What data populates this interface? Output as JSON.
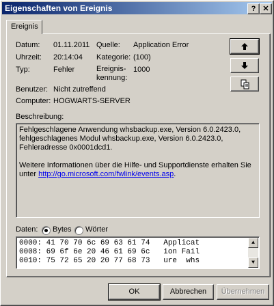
{
  "window": {
    "title": "Eigenschaften von Ereignis",
    "help_glyph": "?",
    "close_glyph": "✕"
  },
  "tab": {
    "label": "Ereignis"
  },
  "fields": {
    "datum_label": "Datum:",
    "datum_value": "01.11.2011",
    "uhrzeit_label": "Uhrzeit:",
    "uhrzeit_value": "20:14:04",
    "typ_label": "Typ:",
    "typ_value": "Fehler",
    "quelle_label": "Quelle:",
    "quelle_value": "Application Error",
    "kategorie_label": "Kategorie:",
    "kategorie_value": "(100)",
    "kennung_label_1": "Ereignis-",
    "kennung_label_2": "kennung:",
    "kennung_value": "1000",
    "benutzer_label": "Benutzer:",
    "benutzer_value": "Nicht zutreffend",
    "computer_label": "Computer:",
    "computer_value": "HOGWARTS-SERVER"
  },
  "side_buttons": {
    "up_icon": "arrow-up-icon",
    "down_icon": "arrow-down-icon",
    "copy_icon": "copy-icon"
  },
  "description": {
    "label": "Beschreibung:",
    "line1": "Fehlgeschlagene Anwendung whsbackup.exe, Version 6.0.2423.0,",
    "line2": "fehlgeschlagenes Modul whsbackup.exe, Version 6.0.2423.0,",
    "line3": "Fehleradresse 0x0001dcd1.",
    "line4": "Weitere Informationen über die Hilfe- und Supportdienste erhalten Sie",
    "line5_prefix": "unter ",
    "link": "http://go.microsoft.com/fwlink/events.asp",
    "line5_suffix": "."
  },
  "data_section": {
    "label": "Daten:",
    "opt_bytes": "Bytes",
    "opt_words": "Wörter",
    "selected": "Bytes",
    "rows": [
      "0000: 41 70 70 6c 69 63 61 74   Applicat",
      "0008: 69 6f 6e 20 46 61 69 6c   ion Fail",
      "0010: 75 72 65 20 20 77 68 73   ure  whs"
    ]
  },
  "footer": {
    "ok": "OK",
    "cancel": "Abbrechen",
    "apply": "Übernehmen"
  }
}
